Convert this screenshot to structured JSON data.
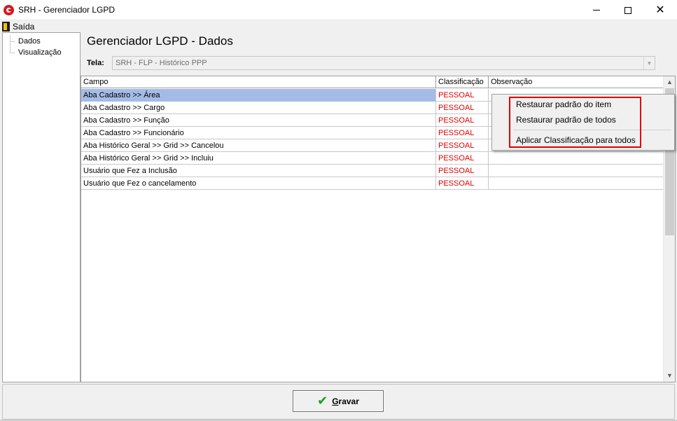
{
  "window": {
    "title": "SRH - Gerenciador LGPD",
    "controls": {
      "minimize": "minimize",
      "maximize": "maximize",
      "close": "✕"
    }
  },
  "menu": {
    "exit_label": "Saída"
  },
  "sidebar": {
    "items": [
      {
        "label": "Dados"
      },
      {
        "label": "Visualização"
      }
    ]
  },
  "panel": {
    "title": "Gerenciador LGPD - Dados",
    "tela_label": "Tela:",
    "tela_value": "SRH - FLP - Histórico PPP"
  },
  "grid": {
    "columns": [
      "Campo",
      "Classificação",
      "Observação"
    ],
    "rows": [
      {
        "campo": "Aba Cadastro >> Área",
        "classificacao": "PESSOAL",
        "observacao": ""
      },
      {
        "campo": "Aba Cadastro >> Cargo",
        "classificacao": "PESSOAL",
        "observacao": ""
      },
      {
        "campo": "Aba Cadastro >> Função",
        "classificacao": "PESSOAL",
        "observacao": ""
      },
      {
        "campo": "Aba Cadastro >> Funcionário",
        "classificacao": "PESSOAL",
        "observacao": ""
      },
      {
        "campo": "Aba Histórico Geral >> Grid >> Cancelou",
        "classificacao": "PESSOAL",
        "observacao": ""
      },
      {
        "campo": "Aba Histórico Geral >> Grid >> Incluiu",
        "classificacao": "PESSOAL",
        "observacao": ""
      },
      {
        "campo": "Usuário que Fez a Inclusão",
        "classificacao": "PESSOAL",
        "observacao": ""
      },
      {
        "campo": "Usuário que Fez o cancelamento",
        "classificacao": "PESSOAL",
        "observacao": ""
      }
    ],
    "selected_row": 0
  },
  "context_menu": {
    "items": [
      {
        "label": "Restaurar padrão do item"
      },
      {
        "label": "Restaurar padrão de todos"
      },
      {
        "label": "Aplicar Classificação para todos"
      }
    ]
  },
  "footer": {
    "save_mnemonic": "G",
    "save_rest": "ravar"
  },
  "colors": {
    "classification_text": "#e00000",
    "selected_row": "#a3bbe6",
    "highlight_box": "#e00000",
    "check_icon": "#1b9e1b"
  }
}
